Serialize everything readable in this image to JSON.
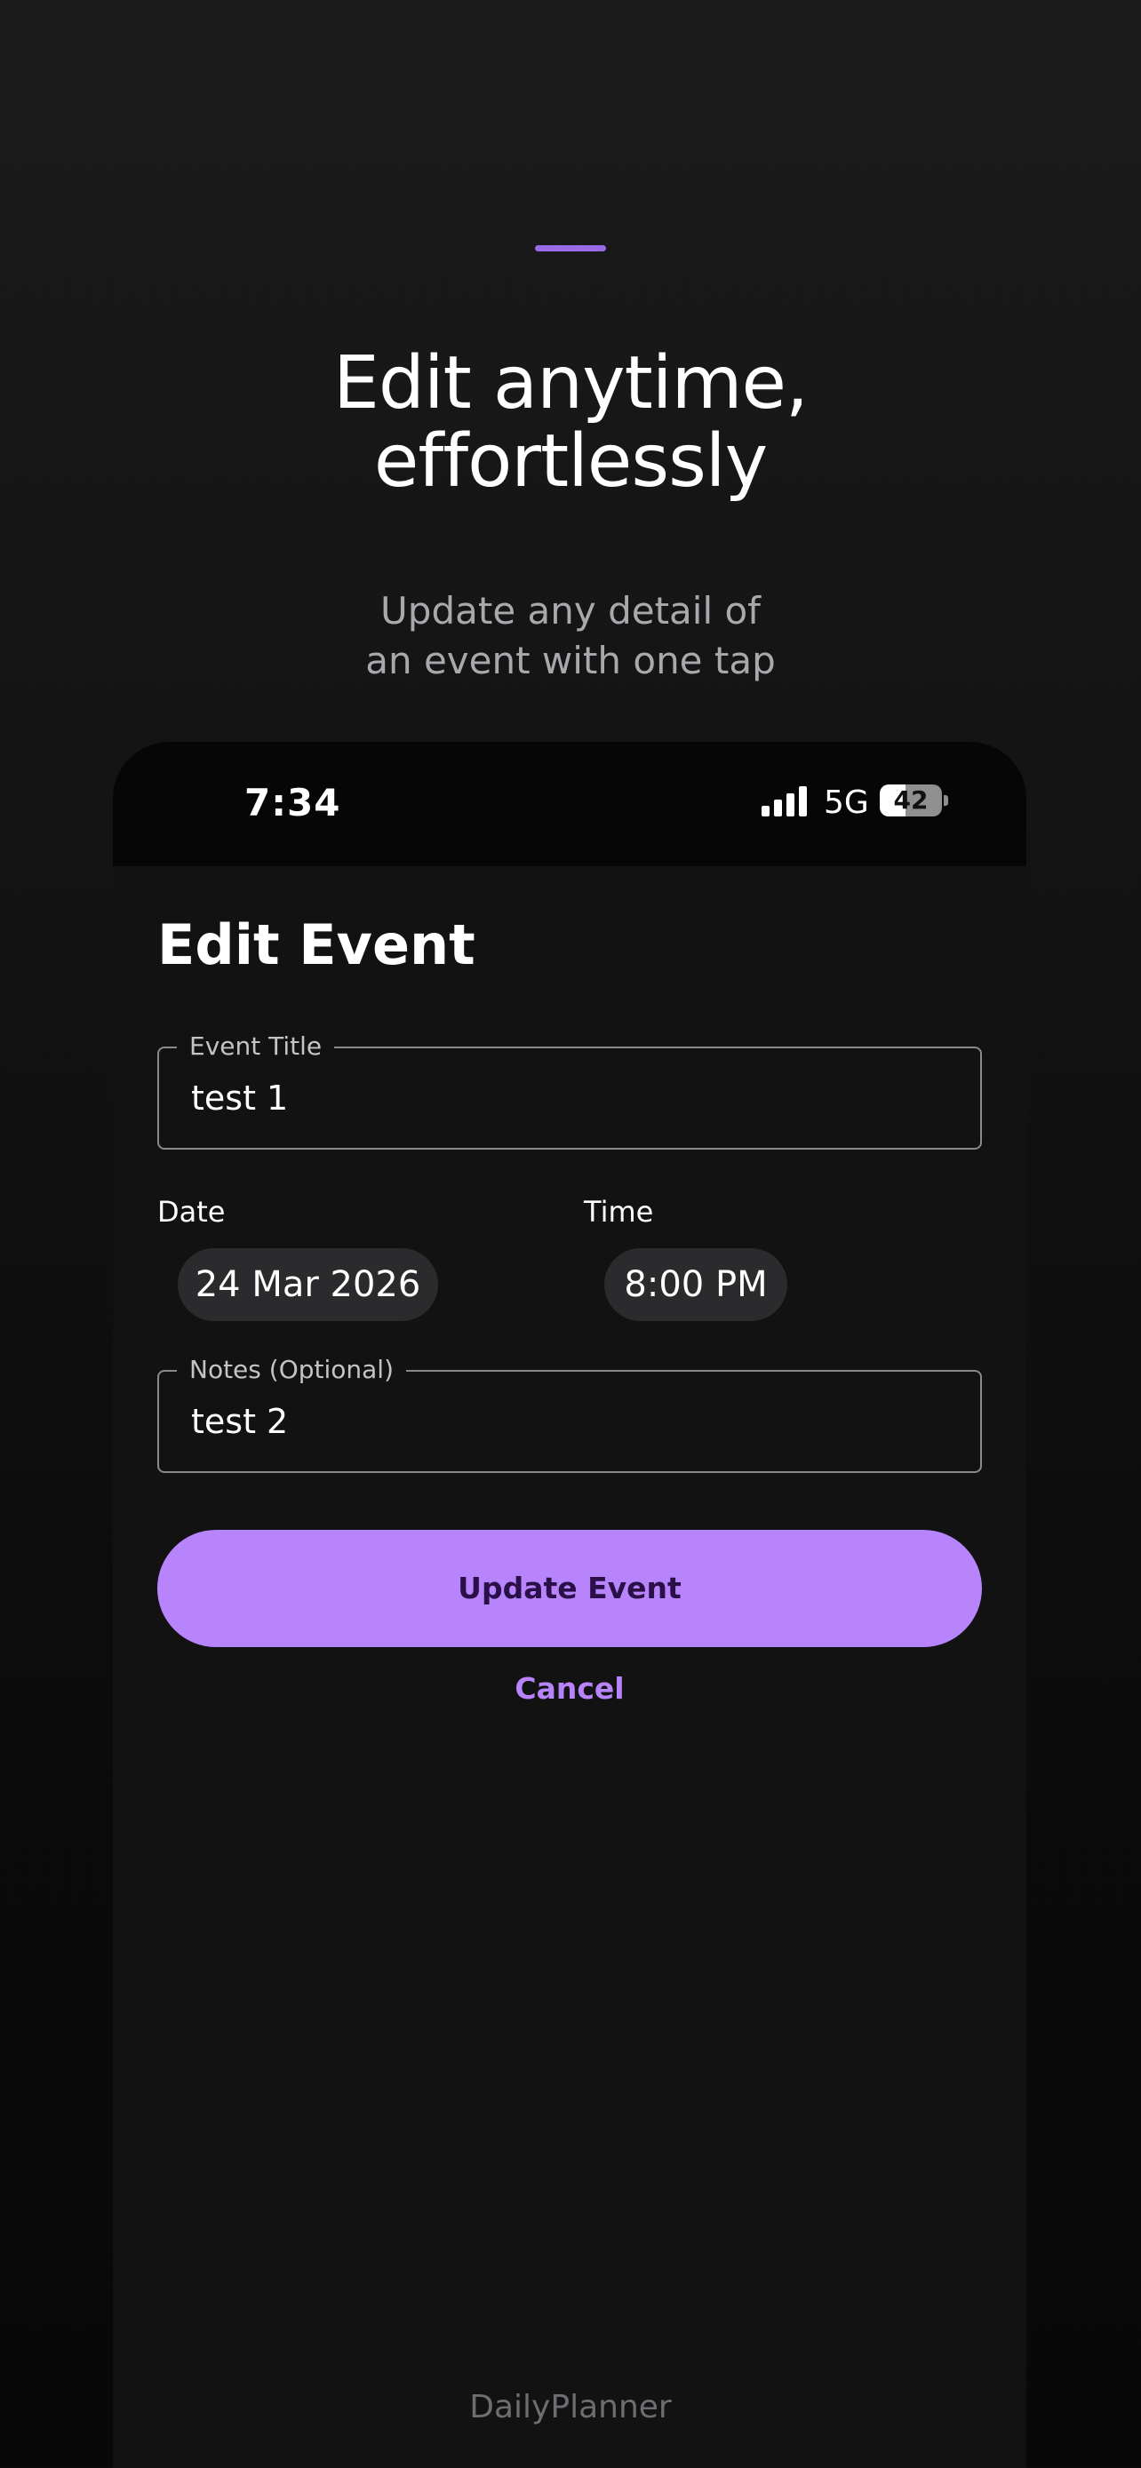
{
  "hero": {
    "headline_line1": "Edit anytime,",
    "headline_line2": "effortlessly",
    "subtitle_line1": "Update any detail of",
    "subtitle_line2": "an event with one tap"
  },
  "status_bar": {
    "time": "7:34",
    "network": "5G",
    "battery": "42",
    "battery_fraction": 0.42,
    "signal_bars": 4,
    "signal_icon": "cellular-signal-icon",
    "battery_icon": "battery-icon"
  },
  "sheet": {
    "title": "Edit Event",
    "event_title": {
      "label": "Event Title",
      "value": "test 1"
    },
    "date": {
      "label": "Date",
      "value": "24 Mar 2026"
    },
    "time": {
      "label": "Time",
      "value": "8:00 PM"
    },
    "notes": {
      "label": "Notes (Optional)",
      "value": "test 2"
    },
    "primary_button": "Update Event",
    "cancel_link": "Cancel"
  },
  "footer": {
    "brand": "DailyPlanner"
  },
  "colors": {
    "accent": "#b784fb",
    "accent_bar": "#9a6be8",
    "background": "#121212",
    "pill": "#2b2b2d"
  }
}
